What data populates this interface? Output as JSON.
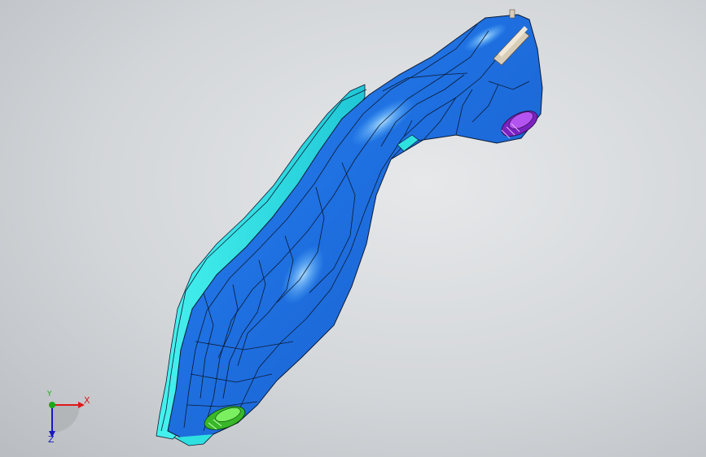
{
  "triad": {
    "x_label": "X",
    "y_label": "Y",
    "z_label": "Z"
  },
  "colors": {
    "background": "#d3d6d9",
    "part_main": "#1e6fe0",
    "part_highlight": "#5ab8ff",
    "flange": "#2fe0e0",
    "edge_lines": "#0b1a33",
    "bushing_front": "#58e040",
    "bushing_rear": "#9a38d8",
    "stud": "#d8cdb8",
    "axis_x": "#e01818",
    "axis_y": "#1aa81a",
    "axis_z": "#1818c0"
  },
  "icons": [
    "coordinate-triad-icon"
  ]
}
